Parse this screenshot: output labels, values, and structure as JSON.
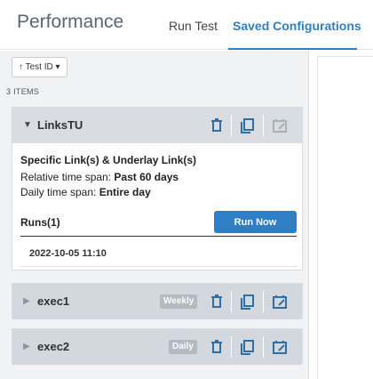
{
  "header": {
    "title": "Performance",
    "tabs": [
      {
        "label": "Run Test",
        "active": false
      },
      {
        "label": "Saved Configurations",
        "active": true
      }
    ]
  },
  "colors": {
    "accent": "#2f7fc6",
    "icon_blue": "#2f6fa8",
    "icon_disabled": "#aab2b9"
  },
  "list": {
    "sort_label": "↑ Test ID ▾",
    "count_label": "3 ITEMS",
    "items": [
      {
        "name": "LinksTU",
        "expanded": true,
        "schedule": "",
        "icons": [
          "trash-icon",
          "copy-icon",
          "calendar-edit-icon"
        ],
        "detail": {
          "type": "Specific Link(s) & Underlay Link(s)",
          "relative_label": "Relative time span:",
          "relative_value": "Past 60 days",
          "daily_label": "Daily time span:",
          "daily_value": "Entire day",
          "runs_label": "Runs(1)",
          "run_now": "Run Now",
          "runs": [
            "2022-10-05 11:10"
          ]
        }
      },
      {
        "name": "exec1",
        "expanded": false,
        "schedule": "Weekly",
        "icons": [
          "trash-icon",
          "copy-icon",
          "calendar-edit-icon"
        ]
      },
      {
        "name": "exec2",
        "expanded": false,
        "schedule": "Daily",
        "icons": [
          "trash-icon",
          "copy-icon",
          "calendar-edit-icon"
        ]
      }
    ]
  }
}
